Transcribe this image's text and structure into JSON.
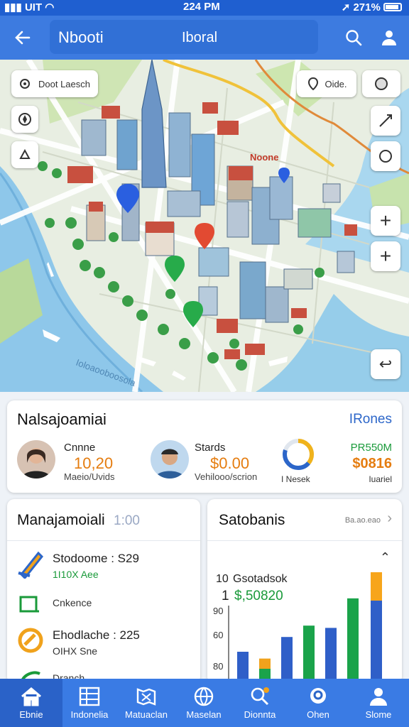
{
  "status_bar": {
    "carrier": "UIT",
    "time": "224 PM",
    "battery": "271%"
  },
  "header": {
    "title": "Nbooti",
    "subtitle": "Iboral"
  },
  "map": {
    "search_label": "Doot Laesch",
    "chip_label": "Oide.",
    "place_label": "Noone"
  },
  "summary_card": {
    "title": "Nalsajoamiai",
    "link": "IRones",
    "person1": {
      "name": "Cnnne",
      "value": "10,20",
      "sub": "Maeio/Uvids"
    },
    "person2": {
      "name": "Stards",
      "value": "$0.00",
      "sub": "Vehilooo/scrion"
    },
    "ring": {
      "label": "I Nesek",
      "percent": 0.8
    },
    "stat": {
      "label": "PR550M",
      "value": "$0816",
      "sub": "Iuariel"
    }
  },
  "manage_card": {
    "title": "Manajamoiali",
    "count": "1:00",
    "items": [
      {
        "title": "Stodoome : S29",
        "sub": "1I10X Aee"
      },
      {
        "title": "Cnkence"
      },
      {
        "title": "Ehodlache : 225",
        "sub": "OIHX Sne"
      },
      {
        "title": "Dranch"
      }
    ]
  },
  "stats_card": {
    "title": "Satobanis",
    "link": "Ba.ao.eao",
    "metric_label": "Gsotadsok",
    "metric_prefix_a": "10",
    "metric_prefix_b": "1",
    "metric_value": "$,50820"
  },
  "chart_data": {
    "type": "bar",
    "y_ticks": [
      "90",
      "60",
      "80"
    ],
    "series": [
      {
        "color": "#2f5fc8",
        "values": [
          0.25,
          0.38,
          0.46,
          0.7
        ]
      },
      {
        "color": "#f0a21c",
        "values": [
          0.19,
          0.35
        ]
      },
      {
        "color": "#1aa34a",
        "values": [
          0.1,
          0.48,
          0.72
        ]
      },
      {
        "color": "#f7a51b",
        "values": [
          0.95
        ]
      }
    ]
  },
  "bottom_nav": [
    {
      "label": "Ebnie",
      "icon": "home-icon"
    },
    {
      "label": "Indonelia",
      "icon": "table-icon"
    },
    {
      "label": "Matuaclan",
      "icon": "map-icon"
    },
    {
      "label": "Maselan",
      "icon": "globe-icon"
    },
    {
      "label": "Dionnta",
      "icon": "search-icon"
    },
    {
      "label": "Ohen",
      "icon": "location-icon"
    },
    {
      "label": "Slome",
      "icon": "person-icon"
    }
  ]
}
